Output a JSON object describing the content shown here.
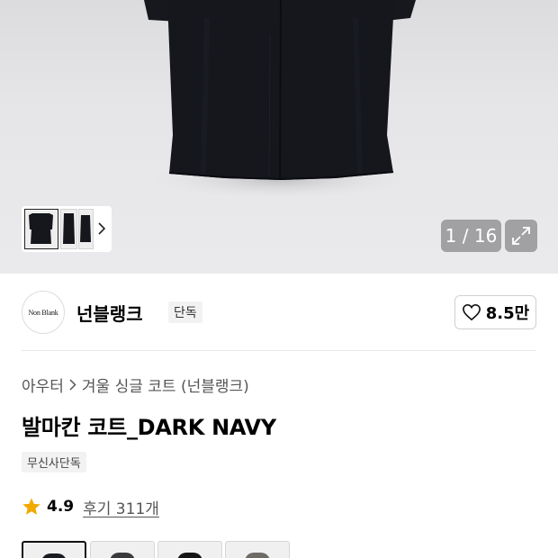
{
  "gallery": {
    "counter": "1 / 16",
    "thumbnails": [
      "coat-front",
      "coat-side",
      "coat-back"
    ]
  },
  "brand": {
    "logo_text": "Non Blank",
    "name": "넌블랭크",
    "tag": "단독",
    "like_count": "8.5만"
  },
  "product": {
    "breadcrumb": [
      "아우터",
      "겨울 싱글 코트 (넌블랭크)"
    ],
    "title": "발마칸 코트_DARK NAVY",
    "badge": "무신사단독",
    "rating": "4.9",
    "review_link": "후기 311개",
    "color_options": [
      {
        "name": "dark-navy",
        "color": "#1a1c22",
        "selected": true
      },
      {
        "name": "charcoal",
        "color": "#3a3a3c",
        "selected": false
      },
      {
        "name": "black",
        "color": "#141414",
        "selected": false
      },
      {
        "name": "grey",
        "color": "#6e6b66",
        "selected": false
      }
    ]
  },
  "colors": {
    "coat": "#15171d",
    "star": "#f2a900",
    "overlay": "#969698"
  }
}
